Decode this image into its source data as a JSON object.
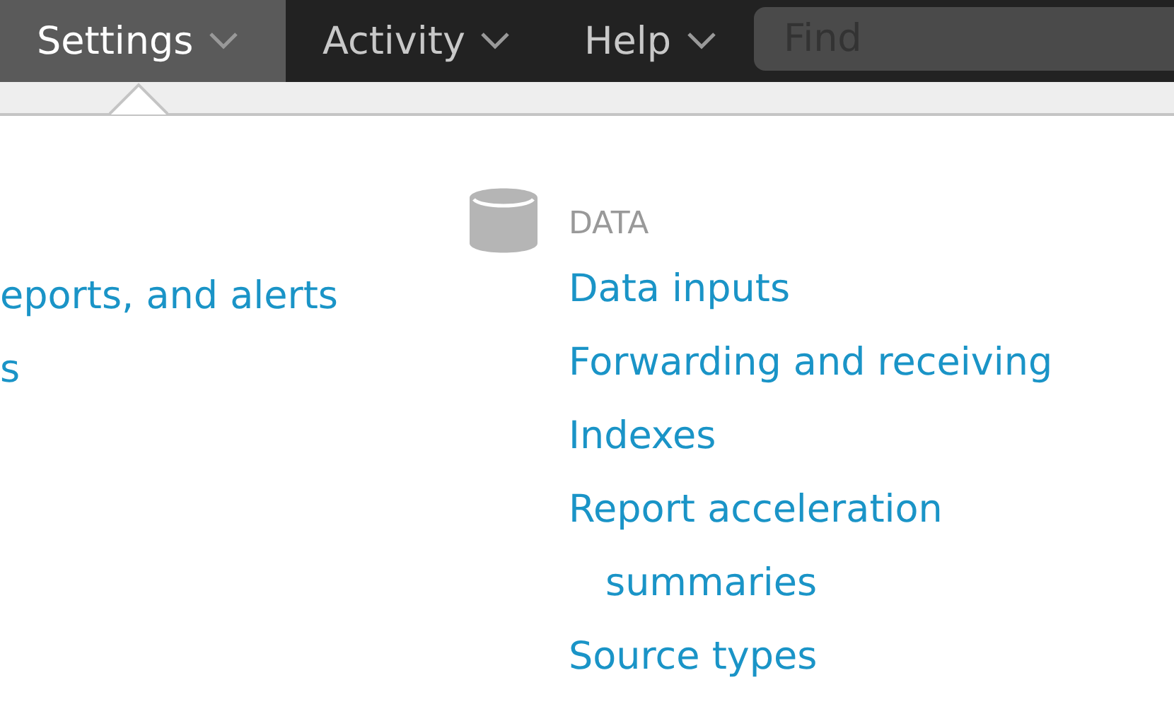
{
  "menu_bar": [
    {
      "label": "Settings",
      "selected": true
    },
    {
      "label": "Activity",
      "selected": false
    },
    {
      "label": "Help",
      "selected": false
    }
  ],
  "search": {
    "placeholder": "Find"
  },
  "left_links": [
    "eports, and alerts",
    "s"
  ],
  "data_section": {
    "heading": "DATA",
    "links": [
      {
        "text": "Data inputs"
      },
      {
        "text": "Forwarding and receiving"
      },
      {
        "text": "Indexes"
      },
      {
        "text": "Report acceleration",
        "continuation": "summaries"
      },
      {
        "text": "Source types"
      }
    ]
  }
}
